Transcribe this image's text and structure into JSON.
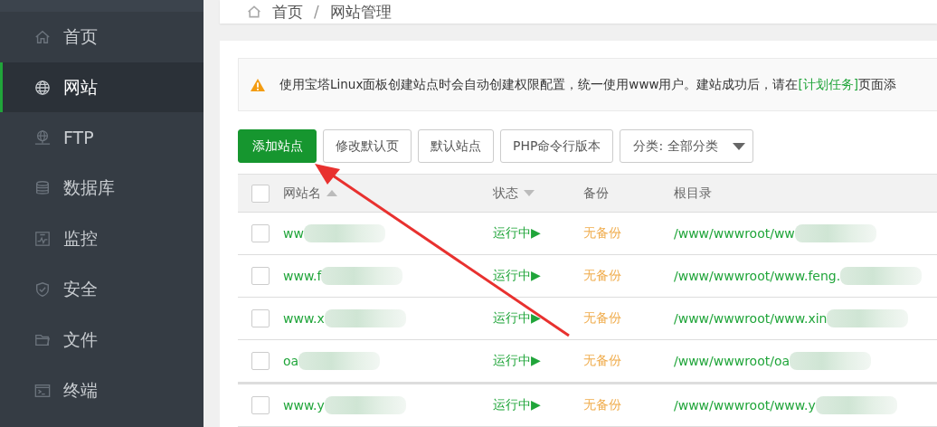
{
  "sidebar": {
    "items": [
      {
        "label": "首页",
        "selected": false
      },
      {
        "label": "网站",
        "selected": true
      },
      {
        "label": "FTP",
        "selected": false
      },
      {
        "label": "数据库",
        "selected": false
      },
      {
        "label": "监控",
        "selected": false
      },
      {
        "label": "安全",
        "selected": false
      },
      {
        "label": "文件",
        "selected": false
      },
      {
        "label": "终端",
        "selected": false
      }
    ]
  },
  "breadcrumb": [
    "首页",
    "/",
    "网站管理"
  ],
  "notice": {
    "text": "使用宝塔Linux面板创建站点时会自动创建权限配置，统一使用www用户。建站成功后，请在",
    "link": "[计划任务]",
    "after": "页面添"
  },
  "toolbar": {
    "primary": "添加站点",
    "buttons": [
      "修改默认页",
      "默认站点",
      "PHP命令行版本"
    ],
    "category": "分类: 全部分类"
  },
  "table": {
    "select_all_checked": false,
    "columns": [
      {
        "label": "网站名",
        "kind": "sort-asc"
      },
      {
        "label": "状态",
        "kind": "sort-desc"
      },
      {
        "label": "备份",
        "kind": "plain"
      },
      {
        "label": "根目录",
        "kind": "plain"
      }
    ],
    "rows": [
      {
        "name": "ww",
        "status": "运行中▶",
        "backup": "无备份",
        "root": "/www/wwwroot/ww",
        "checked": false
      },
      {
        "name": "www.f",
        "status": "运行中▶",
        "backup": "无备份",
        "root": "/www/wwwroot/www.feng.",
        "checked": false
      },
      {
        "name": "www.x",
        "status": "运行中▶",
        "backup": "无备份",
        "root": "/www/wwwroot/www.xin",
        "checked": false
      },
      {
        "name": "oa",
        "status": "运行中▶",
        "backup": "无备份",
        "root": "/www/wwwroot/oa",
        "checked": false
      },
      {
        "name": "www.y",
        "status": "运行中▶",
        "backup": "无备份",
        "root": "/www/wwwroot/www.y",
        "checked": false
      }
    ]
  }
}
